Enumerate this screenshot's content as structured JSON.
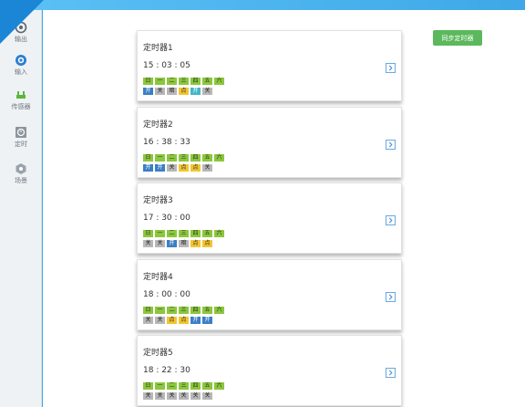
{
  "sidebar": {
    "items": [
      {
        "label": "输出",
        "icon": "output-icon"
      },
      {
        "label": "输入",
        "icon": "input-icon"
      },
      {
        "label": "传感器",
        "icon": "sensor-icon"
      },
      {
        "label": "定时",
        "icon": "timer-icon"
      },
      {
        "label": "场景",
        "icon": "scene-icon"
      }
    ]
  },
  "toolbar": {
    "sync_label": "同步定时器"
  },
  "colors": {
    "day_active": "#8cc63e",
    "weather_gray": "#b8b8b8",
    "weather_blue": "#3b7fc4",
    "weather_yellow": "#f3c531",
    "weather_teal": "#45b6c8",
    "sync_button": "#5cb85c",
    "accent": "#3aa6e6"
  },
  "timers": [
    {
      "name": "定时器1",
      "time": "15 : 03 : 05",
      "days": [
        "日",
        "一",
        "二",
        "三",
        "四",
        "五",
        "六"
      ],
      "weather": [
        {
          "label": "开",
          "color": "blue"
        },
        {
          "label": "关",
          "color": "gray"
        },
        {
          "label": "暗",
          "color": "gray"
        },
        {
          "label": "点",
          "color": "yellow"
        },
        {
          "label": "开",
          "color": "teal"
        },
        {
          "label": "关",
          "color": "gray"
        }
      ]
    },
    {
      "name": "定时器2",
      "time": "16 : 38 : 33",
      "days": [
        "日",
        "一",
        "二",
        "三",
        "四",
        "五",
        "六"
      ],
      "weather": [
        {
          "label": "开",
          "color": "blue"
        },
        {
          "label": "开",
          "color": "blue"
        },
        {
          "label": "关",
          "color": "gray"
        },
        {
          "label": "点",
          "color": "yellow"
        },
        {
          "label": "点",
          "color": "yellow"
        },
        {
          "label": "关",
          "color": "gray"
        }
      ]
    },
    {
      "name": "定时器3",
      "time": "17 : 30 : 00",
      "days": [
        "日",
        "一",
        "二",
        "三",
        "四",
        "五",
        "六"
      ],
      "weather": [
        {
          "label": "关",
          "color": "gray"
        },
        {
          "label": "关",
          "color": "gray"
        },
        {
          "label": "开",
          "color": "blue"
        },
        {
          "label": "暗",
          "color": "gray"
        },
        {
          "label": "点",
          "color": "yellow"
        },
        {
          "label": "点",
          "color": "yellow"
        }
      ]
    },
    {
      "name": "定时器4",
      "time": "18 : 00 : 00",
      "days": [
        "日",
        "一",
        "二",
        "三",
        "四",
        "五",
        "六"
      ],
      "weather": [
        {
          "label": "关",
          "color": "gray"
        },
        {
          "label": "关",
          "color": "gray"
        },
        {
          "label": "点",
          "color": "yellow"
        },
        {
          "label": "点",
          "color": "yellow"
        },
        {
          "label": "开",
          "color": "blue"
        },
        {
          "label": "开",
          "color": "blue"
        }
      ]
    },
    {
      "name": "定时器5",
      "time": "18 : 22 : 30",
      "days": [
        "日",
        "一",
        "二",
        "三",
        "四",
        "五",
        "六"
      ],
      "weather": [
        {
          "label": "关",
          "color": "gray"
        },
        {
          "label": "关",
          "color": "gray"
        },
        {
          "label": "关",
          "color": "gray"
        },
        {
          "label": "关",
          "color": "gray"
        },
        {
          "label": "关",
          "color": "gray"
        },
        {
          "label": "关",
          "color": "gray"
        }
      ]
    }
  ]
}
